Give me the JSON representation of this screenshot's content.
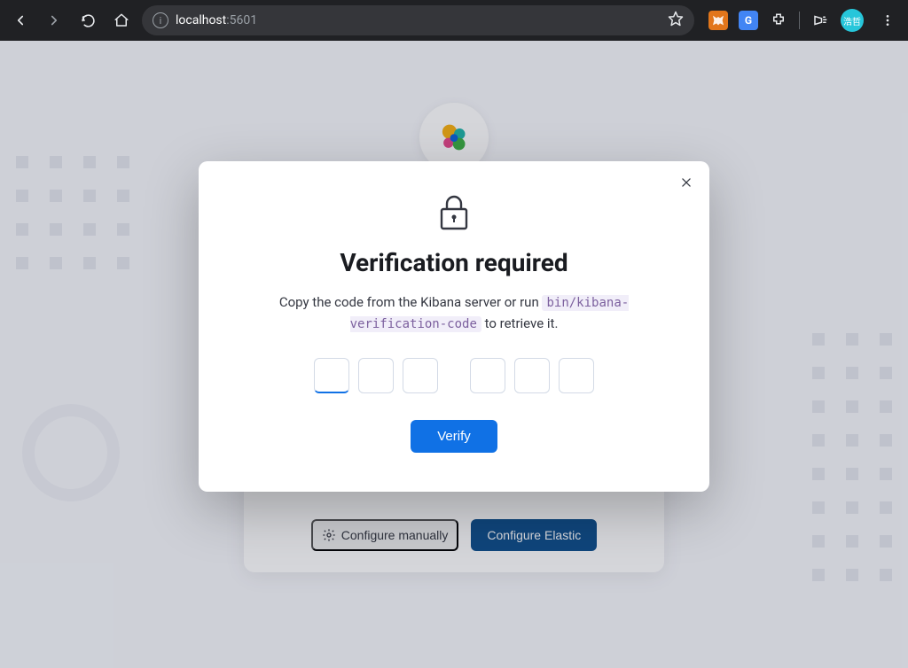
{
  "browser": {
    "url_host": "localhost",
    "url_port": ":5601",
    "avatar_text": "浩哲"
  },
  "modal": {
    "title": "Verification required",
    "description_prefix": "Copy the code from the Kibana server or run ",
    "description_command": "bin/kibana-verification-code",
    "description_suffix": " to retrieve it.",
    "verify_label": "Verify",
    "code_digits": [
      "",
      "",
      "",
      "",
      "",
      ""
    ]
  },
  "setup": {
    "configure_manually": "Configure manually",
    "configure_elastic": "Configure Elastic"
  }
}
